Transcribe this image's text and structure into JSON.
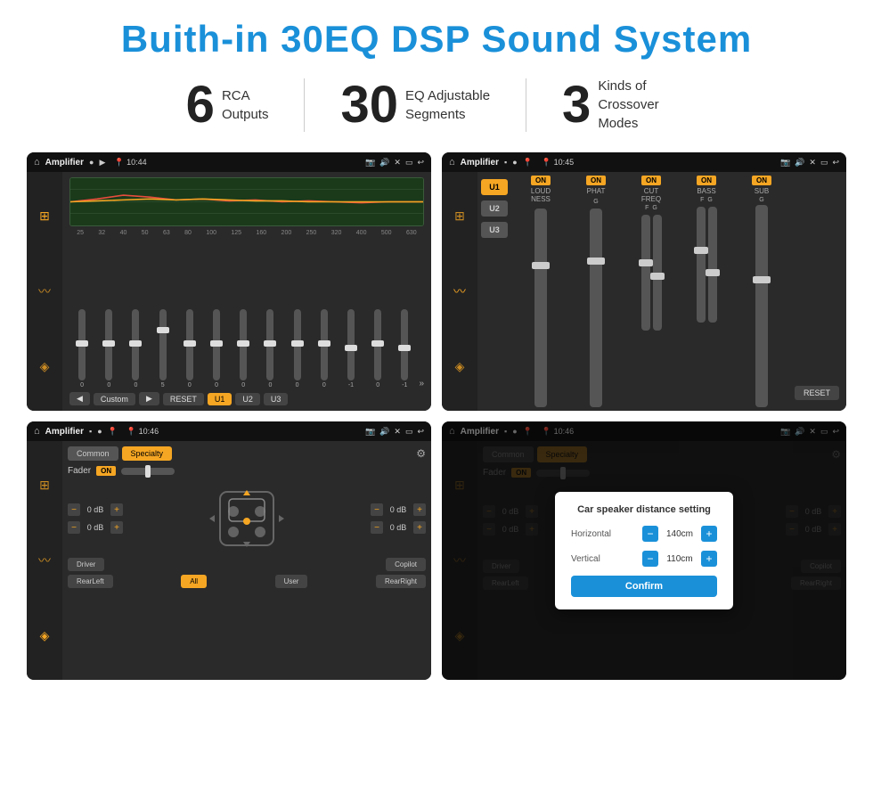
{
  "page": {
    "title": "Buith-in 30EQ DSP Sound System",
    "stats": [
      {
        "number": "6",
        "label": "RCA\nOutputs"
      },
      {
        "number": "30",
        "label": "EQ Adjustable\nSegments"
      },
      {
        "number": "3",
        "label": "Kinds of\nCrossover Modes"
      }
    ]
  },
  "screens": {
    "screen1": {
      "app_name": "Amplifier",
      "time": "10:44",
      "freq_labels": [
        "25",
        "32",
        "40",
        "50",
        "63",
        "80",
        "100",
        "125",
        "160",
        "200",
        "250",
        "320",
        "400",
        "500",
        "630"
      ],
      "slider_values": [
        "0",
        "0",
        "0",
        "5",
        "0",
        "0",
        "0",
        "0",
        "0",
        "0",
        "-1",
        "0",
        "-1"
      ],
      "preset": "Custom",
      "buttons": [
        "RESET",
        "U1",
        "U2",
        "U3"
      ]
    },
    "screen2": {
      "app_name": "Amplifier",
      "time": "10:45",
      "u_buttons": [
        "U1",
        "U2",
        "U3"
      ],
      "channels": [
        "LOUDNESS",
        "PHAT",
        "CUT FREQ",
        "BASS",
        "SUB"
      ],
      "reset_label": "RESET"
    },
    "screen3": {
      "app_name": "Amplifier",
      "time": "10:46",
      "tabs": [
        "Common",
        "Specialty"
      ],
      "fader_label": "Fader",
      "on_label": "ON",
      "vol_controls": [
        {
          "label": "0 dB"
        },
        {
          "label": "0 dB"
        },
        {
          "label": "0 dB"
        },
        {
          "label": "0 dB"
        }
      ],
      "positions": [
        "Driver",
        "Copilot",
        "RearLeft",
        "All",
        "User",
        "RearRight"
      ]
    },
    "screen4": {
      "app_name": "Amplifier",
      "time": "10:46",
      "tabs": [
        "Common",
        "Specialty"
      ],
      "on_label": "ON",
      "dialog": {
        "title": "Car speaker distance setting",
        "horizontal_label": "Horizontal",
        "horizontal_value": "140cm",
        "vertical_label": "Vertical",
        "vertical_value": "110cm",
        "confirm_label": "Confirm"
      },
      "positions": [
        "Driver",
        "Copilot",
        "RearLeft",
        "All",
        "User",
        "RearRight"
      ]
    }
  },
  "colors": {
    "accent": "#f5a623",
    "brand": "#1a90d9",
    "bg_dark": "#1a1a1a",
    "bg_med": "#2a2a2a"
  }
}
